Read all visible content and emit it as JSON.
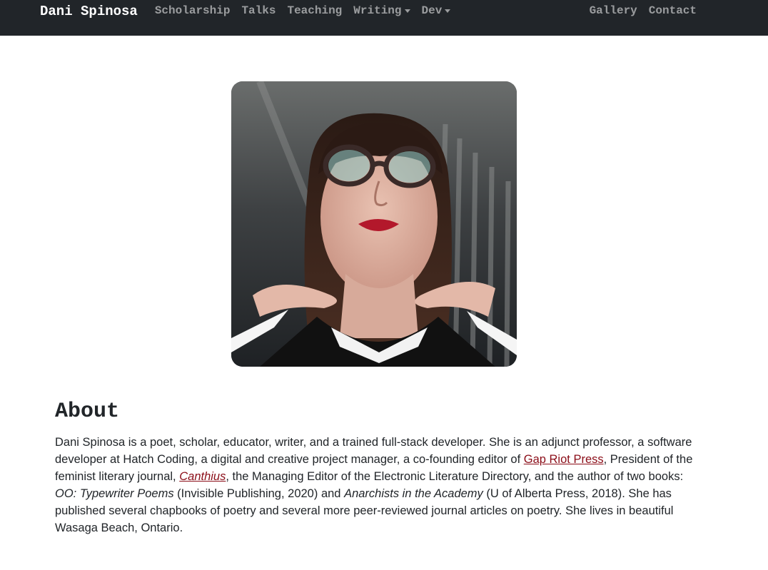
{
  "navbar": {
    "brand": "Dani Spinosa",
    "left_links": [
      {
        "label": "Scholarship",
        "dropdown": false
      },
      {
        "label": "Talks",
        "dropdown": false
      },
      {
        "label": "Teaching",
        "dropdown": false
      },
      {
        "label": "Writing",
        "dropdown": true
      },
      {
        "label": "Dev",
        "dropdown": true
      }
    ],
    "right_links": [
      {
        "label": "Gallery"
      },
      {
        "label": "Contact"
      }
    ]
  },
  "about": {
    "heading": "About",
    "p1": "Dani Spinosa is a poet, scholar, educator, writer, and a trained full-stack developer. She is an adjunct professor, a software developer at Hatch Coding, a digital and creative project manager, a co-founding editor of ",
    "link_gap_riot": "Gap Riot Press",
    "p2": ", President of the feminist literary journal, ",
    "link_canthius": "Canthius",
    "p3": ", the Managing Editor of the Electronic Literature Directory, and the author of two books: ",
    "book1": "OO: Typewriter Poems",
    "p4": " (Invisible Publishing, 2020) and ",
    "book2": "Anarchists in the Academy",
    "p5": " (U of Alberta Press, 2018). She has published several chapbooks of poetry and several more peer-reviewed journal articles on poetry. She lives in beautiful Wasaga Beach, Ontario."
  },
  "colors": {
    "navbar_bg": "#212529",
    "link": "#8b0d18",
    "text": "#212529"
  }
}
